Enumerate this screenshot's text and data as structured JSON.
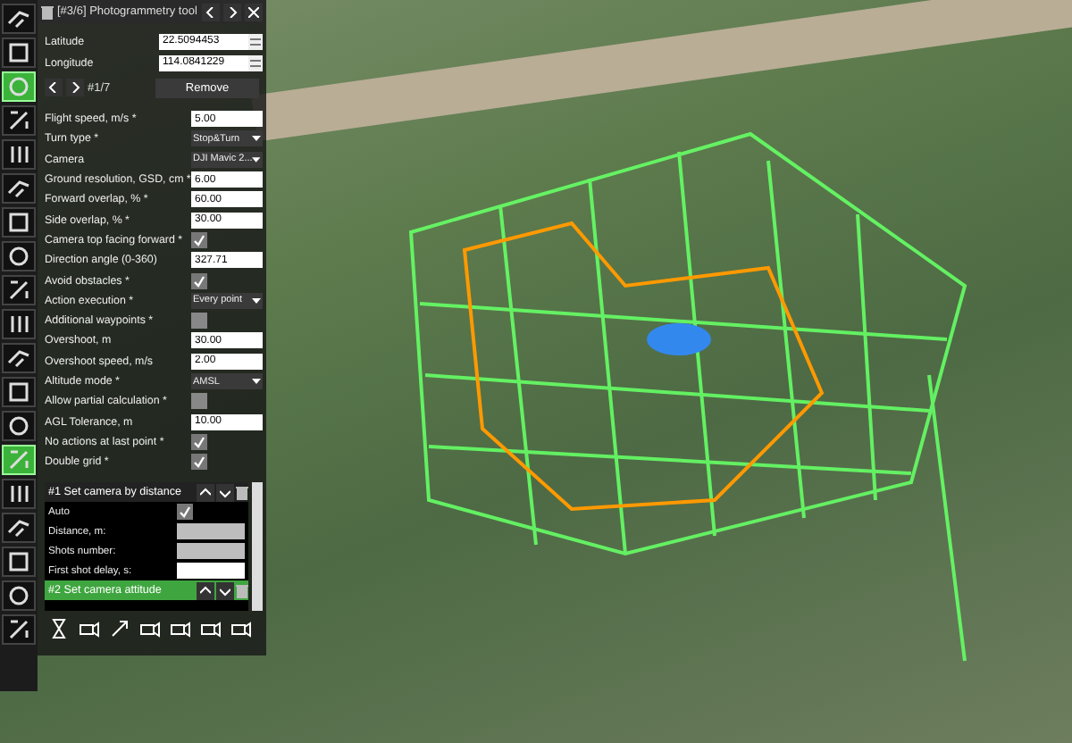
{
  "toolbar": {
    "buttons": [
      {
        "selected": false
      },
      {
        "selected": false
      },
      {
        "selected": true
      },
      {
        "selected": false
      },
      {
        "selected": false
      },
      {
        "selected": false
      },
      {
        "selected": false
      },
      {
        "selected": false
      },
      {
        "selected": false
      },
      {
        "selected": false
      },
      {
        "selected": false
      },
      {
        "selected": false
      },
      {
        "selected": false
      },
      {
        "selected": true
      },
      {
        "selected": false
      },
      {
        "selected": false
      },
      {
        "selected": false
      },
      {
        "selected": false
      },
      {
        "selected": false
      }
    ]
  },
  "panel": {
    "title": "[#3/6] Photogrammetry tool",
    "coordinates": [
      {
        "label": "Latitude",
        "value": "22.5094453"
      },
      {
        "label": "Longitude",
        "value": "114.0841229"
      }
    ],
    "pager": "#1/7",
    "remove_label": "Remove",
    "params": [
      {
        "label": "Flight speed, m/s *",
        "kind": "input",
        "value": "5.00"
      },
      {
        "label": "Turn type *",
        "kind": "select",
        "value": "Stop&Turn"
      },
      {
        "label": "Camera",
        "kind": "select",
        "value": "DJI Mavic 2..."
      },
      {
        "label": "Ground resolution, GSD, cm *",
        "kind": "input",
        "value": "6.00"
      },
      {
        "label": "Forward overlap, % *",
        "kind": "input",
        "value": "60.00"
      },
      {
        "label": "Side overlap, % *",
        "kind": "input",
        "value": "30.00"
      },
      {
        "label": "Camera top facing forward *",
        "kind": "checkbox",
        "checked": true
      },
      {
        "label": "Direction angle (0-360)",
        "kind": "input",
        "value": "327.71"
      },
      {
        "label": "Avoid obstacles *",
        "kind": "checkbox",
        "checked": true
      },
      {
        "label": "Action execution *",
        "kind": "select",
        "value": "Every point"
      },
      {
        "label": "Additional waypoints *",
        "kind": "checkbox",
        "checked": false
      },
      {
        "label": "Overshoot, m",
        "kind": "input",
        "value": "30.00"
      },
      {
        "label": "Overshoot speed, m/s",
        "kind": "input",
        "value": "2.00"
      },
      {
        "label": "Altitude mode *",
        "kind": "select",
        "value": "AMSL"
      },
      {
        "label": "Allow partial calculation *",
        "kind": "checkbox",
        "checked": false
      },
      {
        "label": "AGL Tolerance, m",
        "kind": "input",
        "value": "10.00"
      },
      {
        "label": "No actions at last point *",
        "kind": "checkbox",
        "checked": true
      },
      {
        "label": "Double grid *",
        "kind": "checkbox",
        "checked": true
      }
    ],
    "actions": [
      {
        "title": "#1 Set camera by distance",
        "selected": false,
        "fields": [
          {
            "label": "Auto",
            "kind": "checkbox",
            "checked": true
          },
          {
            "label": "Distance, m:",
            "kind": "input",
            "disabled": true
          },
          {
            "label": "Shots number:",
            "kind": "input",
            "disabled": true
          },
          {
            "label": "First shot delay, s:",
            "kind": "input",
            "disabled": false
          }
        ]
      },
      {
        "title": "#2 Set camera attitude",
        "selected": true
      }
    ]
  }
}
